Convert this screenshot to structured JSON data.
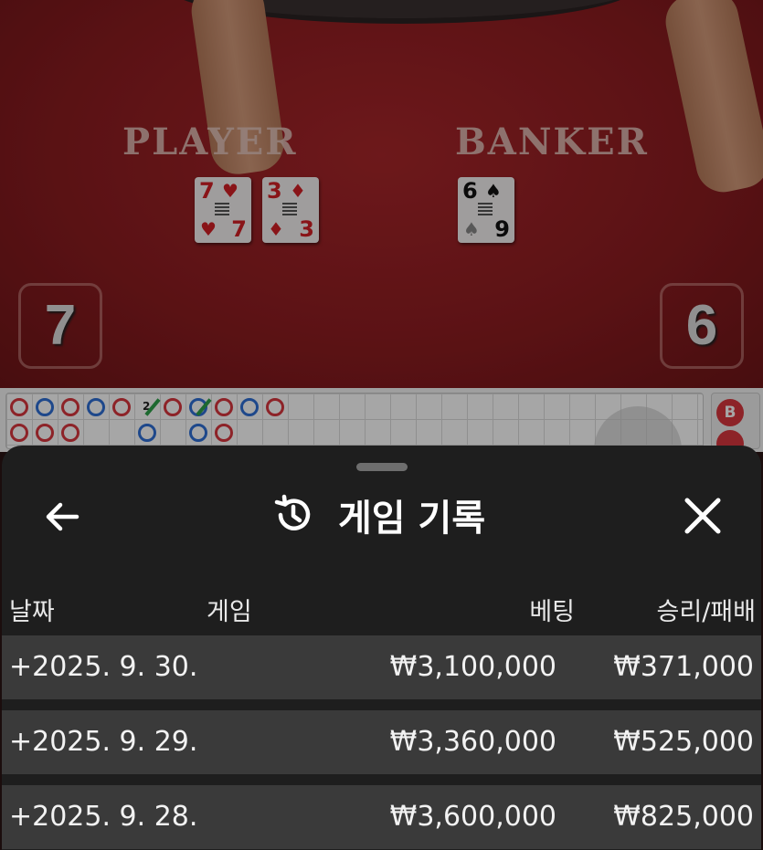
{
  "video": {
    "player_label": "PLAYER",
    "banker_label": "BANKER",
    "player_score": "7",
    "banker_score": "6",
    "player_cards": [
      {
        "rank": "7",
        "suit": "♥",
        "color": "red"
      },
      {
        "rank": "3",
        "suit": "♦",
        "color": "red"
      }
    ],
    "banker_cards": [
      {
        "rank": "6",
        "suit": "♠",
        "color": "black",
        "rank_bottom": "9"
      }
    ]
  },
  "roadmap": {
    "tie_count": "2",
    "side_badge": "B"
  },
  "sheet": {
    "title": "게임 기록",
    "back_icon": "arrow-left-icon",
    "history_icon": "history-icon",
    "close_icon": "close-icon",
    "columns": {
      "date": "날짜",
      "game": "게임",
      "bet": "베팅",
      "result": "승리/패배"
    },
    "rows": [
      {
        "date": "+2025. 9. 30.",
        "bet": "₩3,100,000",
        "result": "₩371,000"
      },
      {
        "date": "+2025. 9. 29.",
        "bet": "₩3,360,000",
        "result": "₩525,000"
      },
      {
        "date": "+2025. 9. 28.",
        "bet": "₩3,600,000",
        "result": "₩825,000"
      }
    ]
  },
  "colors": {
    "felt": "#a8262a",
    "banker_red": "#d9363e",
    "player_blue": "#2f6fd6",
    "tie_green": "#2da14a",
    "sheet_bg": "#1e1e1e",
    "row_bg": "#3a3a3a"
  }
}
